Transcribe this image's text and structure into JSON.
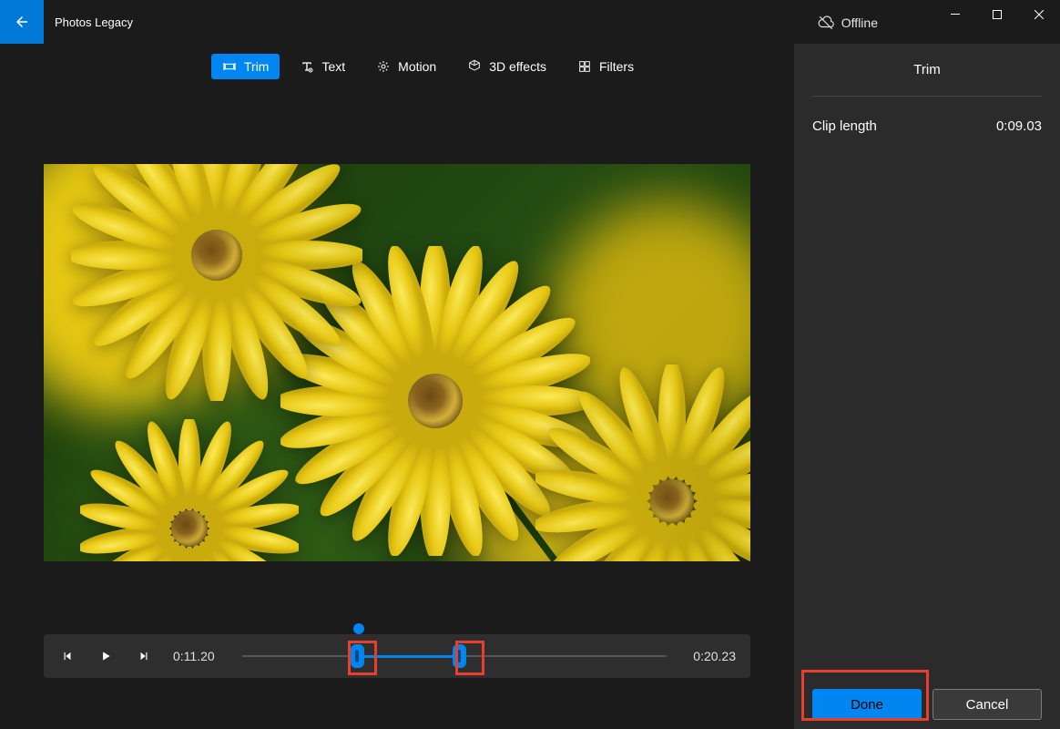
{
  "app": {
    "title": "Photos Legacy"
  },
  "status": {
    "offline_label": "Offline"
  },
  "toolbar": {
    "trim": "Trim",
    "text": "Text",
    "motion": "Motion",
    "effects": "3D effects",
    "filters": "Filters"
  },
  "player": {
    "current_time": "0:11.20",
    "total_time": "0:20.23"
  },
  "panel": {
    "title": "Trim",
    "clip_length_label": "Clip length",
    "clip_length_value": "0:09.03"
  },
  "actions": {
    "done": "Done",
    "cancel": "Cancel"
  }
}
